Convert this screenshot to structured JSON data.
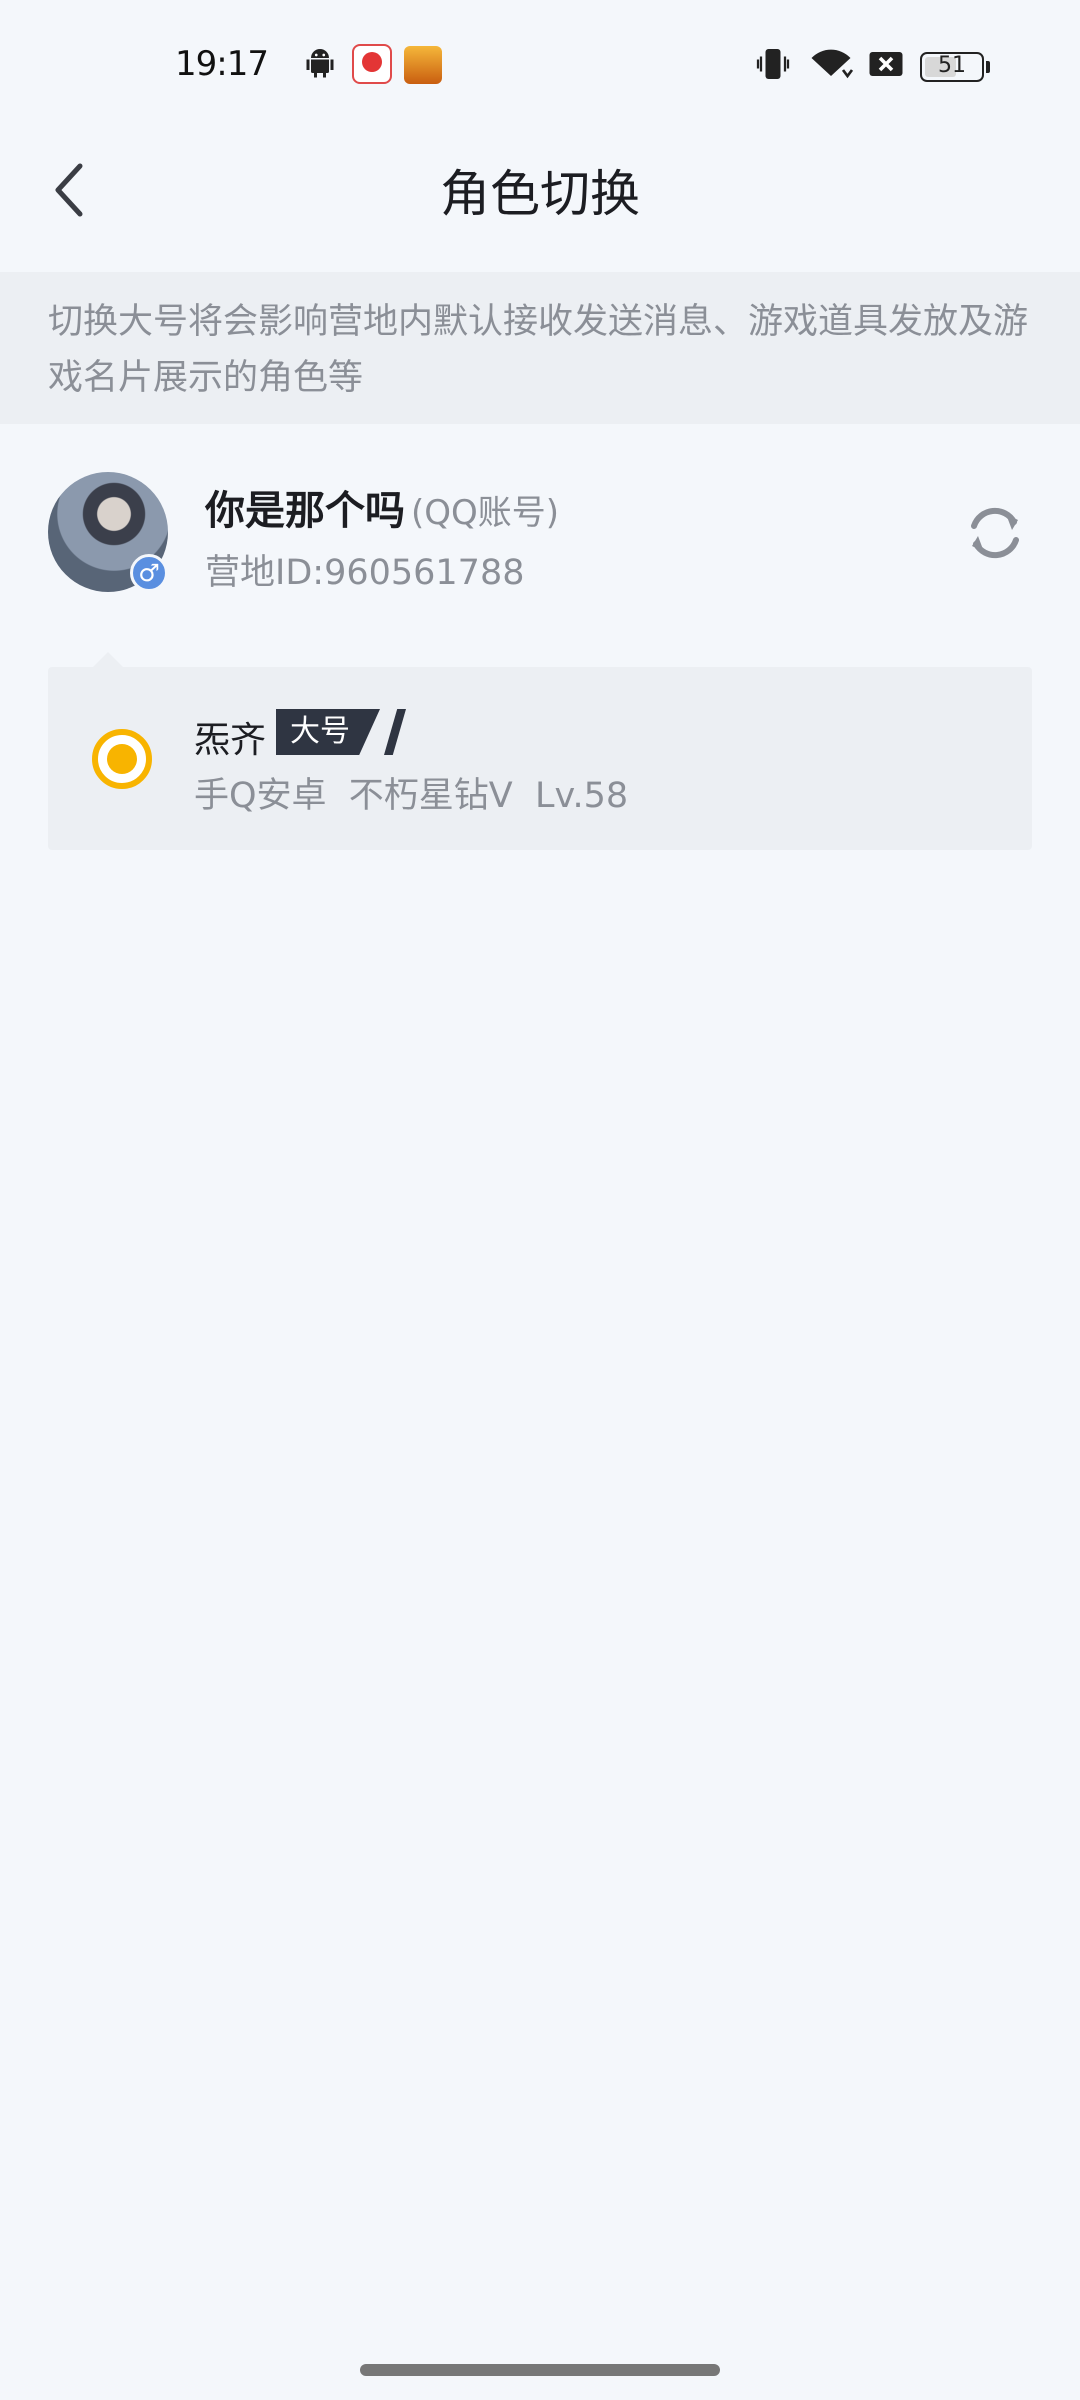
{
  "status_bar": {
    "time": "19:17",
    "battery": "51",
    "battery_level": 0.51
  },
  "header": {
    "title": "角色切换"
  },
  "notice": {
    "text": "切换大号将会影响营地内默认接收发送消息、游戏道具发放及游戏名片展示的角色等"
  },
  "account": {
    "name": "你是那个吗",
    "type": "(QQ账号)",
    "camp_id": "营地ID:960561788",
    "gender_symbol": "♂"
  },
  "roles": [
    {
      "name": "炁齐",
      "tag": "大号",
      "detail": "手Q安卓  不朽星钻V  Lv.58",
      "selected": true
    }
  ],
  "colors": {
    "accent": "#f8b400",
    "tag_bg": "#2f3542",
    "page_bg": "#f4f7fb"
  }
}
